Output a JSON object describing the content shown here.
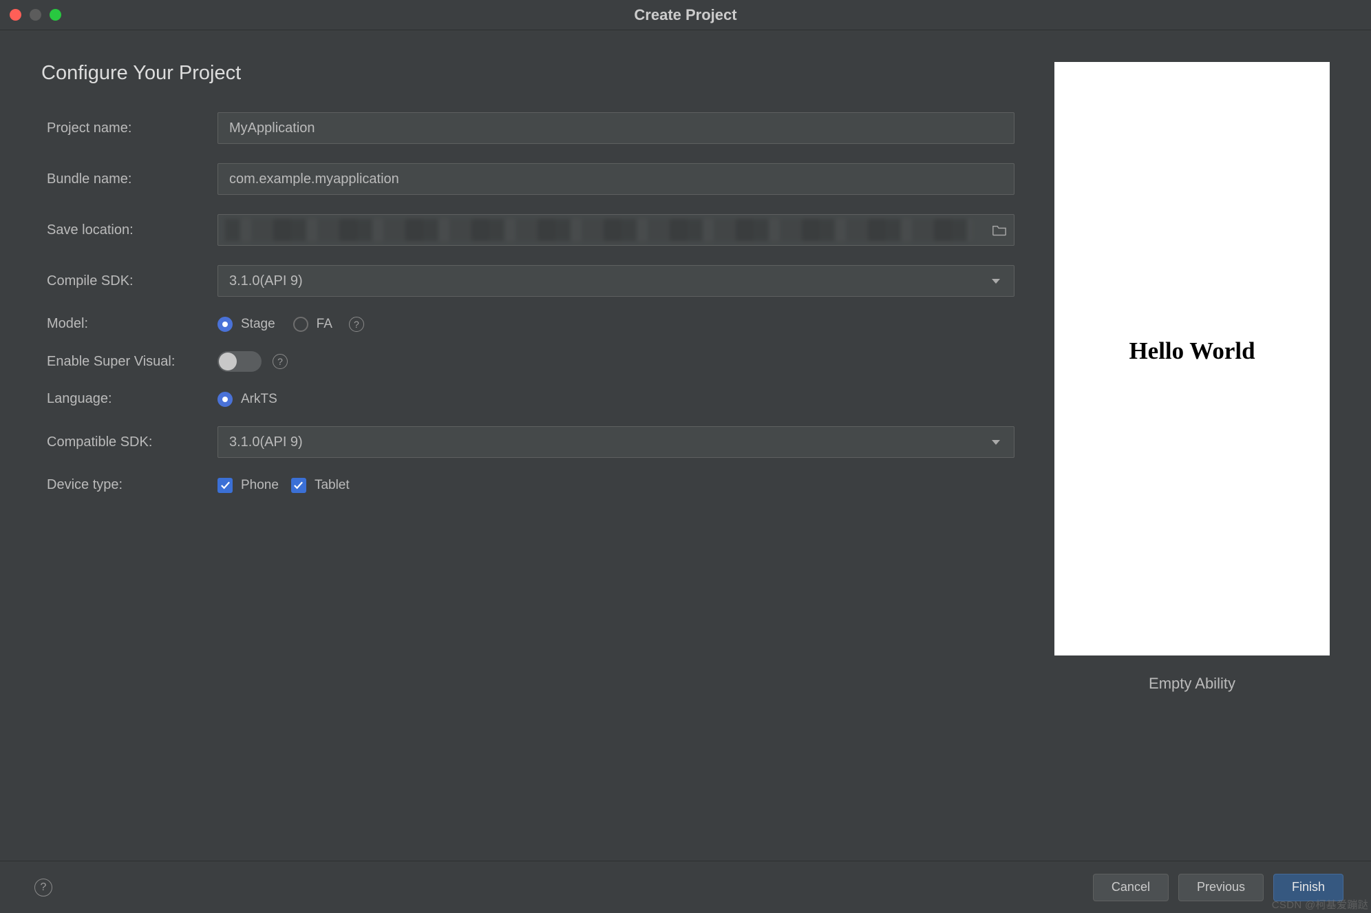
{
  "title": "Create Project",
  "heading": "Configure Your Project",
  "labels": {
    "project_name": "Project name:",
    "bundle_name": "Bundle name:",
    "save_location": "Save location:",
    "compile_sdk": "Compile SDK:",
    "model": "Model:",
    "enable_super_visual": "Enable Super Visual:",
    "language": "Language:",
    "compatible_sdk": "Compatible SDK:",
    "device_type": "Device type:"
  },
  "fields": {
    "project_name": "MyApplication",
    "bundle_name": "com.example.myapplication",
    "save_location": "",
    "compile_sdk": "3.1.0(API 9)",
    "compatible_sdk": "3.1.0(API 9)"
  },
  "model_options": {
    "stage": "Stage",
    "fa": "FA"
  },
  "model_selected": "stage",
  "enable_super_visual": false,
  "language_options": {
    "arkts": "ArkTS"
  },
  "language_selected": "arkts",
  "device_types": {
    "phone": {
      "label": "Phone",
      "checked": true
    },
    "tablet": {
      "label": "Tablet",
      "checked": true
    }
  },
  "preview": {
    "text": "Hello World",
    "caption": "Empty Ability"
  },
  "footer": {
    "cancel": "Cancel",
    "previous": "Previous",
    "finish": "Finish"
  },
  "watermark": "CSDN @柯基爱蹦跶"
}
